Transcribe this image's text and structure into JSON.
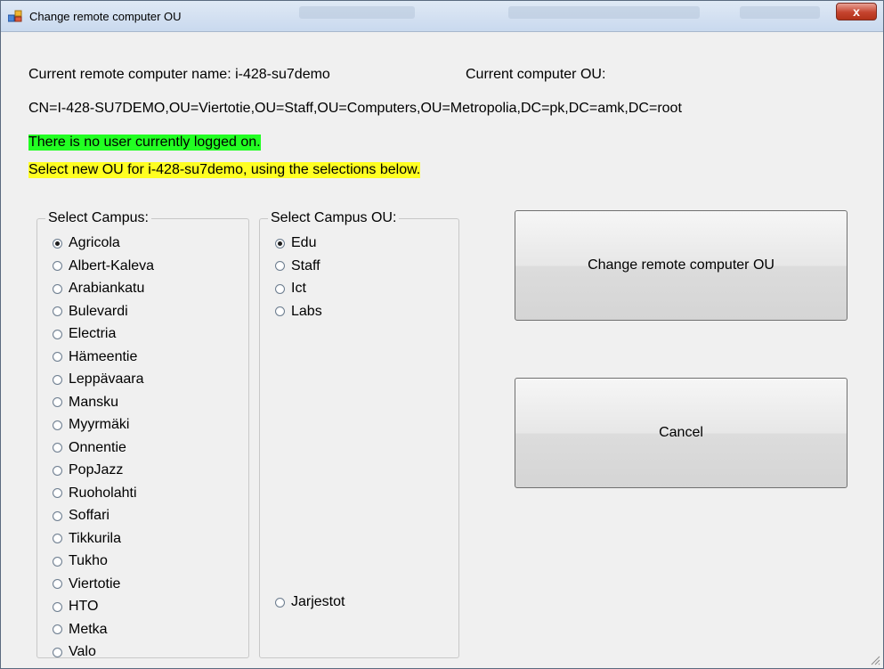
{
  "window": {
    "title": "Change remote computer OU",
    "close_glyph": "x"
  },
  "info": {
    "computer_name_text": "Current remote computer name: i-428-su7demo",
    "computer_ou_label": "Current computer OU:",
    "current_ou_dn": "CN=I-428-SU7DEMO,OU=Viertotie,OU=Staff,OU=Computers,OU=Metropolia,DC=pk,DC=amk,DC=root",
    "login_status": "There is no user currently logged on.",
    "instruction": "Select new OU for i-428-su7demo, using the selections below."
  },
  "campus_group": {
    "legend": "Select Campus:",
    "options": [
      "Agricola",
      "Albert-Kaleva",
      "Arabiankatu",
      "Bulevardi",
      "Electria",
      "Hämeentie",
      "Leppävaara",
      "Mansku",
      "Myyrmäki",
      "Onnentie",
      "PopJazz",
      "Ruoholahti",
      "Soffari",
      "Tikkurila",
      "Tukho",
      "Viertotie",
      "HTO",
      "Metka",
      "Valo"
    ],
    "selected": "Agricola"
  },
  "campus_ou_group": {
    "legend": "Select Campus OU:",
    "options": [
      "Edu",
      "Staff",
      "Ict",
      "Labs"
    ],
    "extra_option": "Jarjestot",
    "selected": "Edu"
  },
  "buttons": {
    "change": "Change remote computer OU",
    "cancel": "Cancel"
  },
  "colors": {
    "login_status_bg": "#22ff22",
    "instruction_bg": "#ffff22",
    "close_button": "#c5432e"
  }
}
